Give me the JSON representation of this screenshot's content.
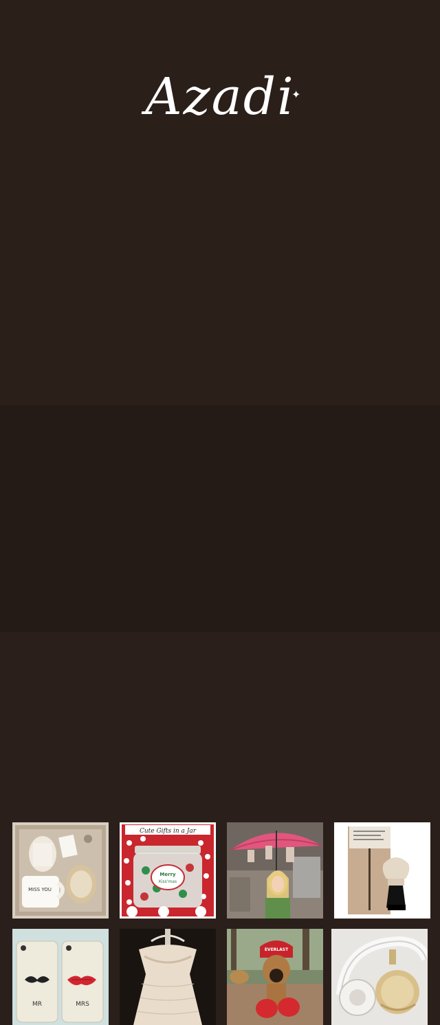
{
  "brand": {
    "name": "Azadi"
  },
  "gallery": {
    "items": [
      {
        "name": "gift-box-mugs",
        "caption": "MISS YOU"
      },
      {
        "name": "gift-jar",
        "title": "Cute Gifts in a Jar",
        "label": "Merry Kiss'mas"
      },
      {
        "name": "girl-with-umbrella"
      },
      {
        "name": "shaving-brush-set"
      },
      {
        "name": "mr-mrs-phone-cases",
        "left_label": "MR",
        "right_label": "MRS"
      },
      {
        "name": "lace-dress"
      },
      {
        "name": "boxer-dog",
        "label": "EVERLAST"
      },
      {
        "name": "headphones"
      }
    ]
  }
}
